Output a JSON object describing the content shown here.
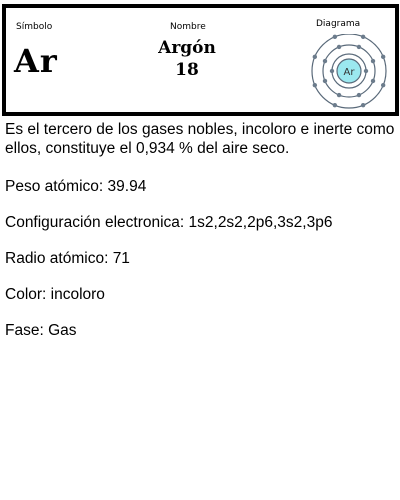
{
  "header": {
    "symbol_label": "Símbolo",
    "name_label": "Nombre",
    "diagram_label": "Diagrama",
    "symbol": "Ar",
    "name": "Argón",
    "atomic_number": "18",
    "nucleus_label": "Ar"
  },
  "details": {
    "description": "Es el tercero de los gases nobles, incoloro e inerte como ellos, constituye el 0,934 % del aire seco.",
    "atomic_weight": "Peso atómico: 39.94",
    "electron_config": "Configuración electronica: 1s2,2s2,2p6,3s2,3p6",
    "atomic_radius": "Radio atómico: 71",
    "color": "Color: incoloro",
    "phase": "Fase: Gas"
  },
  "colors": {
    "border": "#000000",
    "nucleus_fill": "#9be8ef",
    "orbit": "#5a6a7a",
    "electron": "#6c7c8c"
  }
}
